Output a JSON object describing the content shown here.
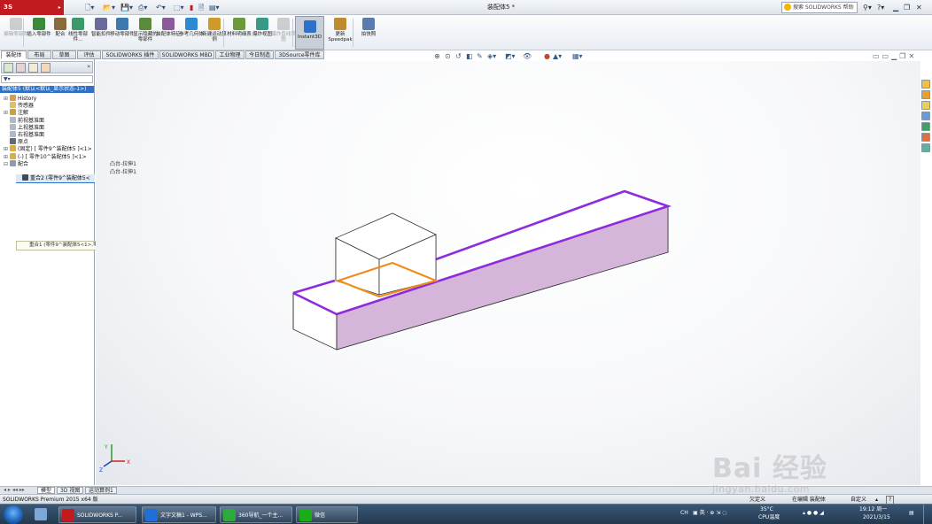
{
  "app": {
    "title": "装配体5 *",
    "help_search_placeholder": "搜索 SOLIDWORKS 帮助"
  },
  "command_manager": {
    "items": [
      {
        "label": "编辑零部件",
        "icon": "edit-component-icon",
        "enabled": false
      },
      {
        "label": "插入零部件",
        "icon": "insert-component-icon",
        "enabled": true
      },
      {
        "label": "配合",
        "icon": "mate-icon",
        "enabled": true
      },
      {
        "label": "线性零部件...",
        "icon": "linear-pattern-icon",
        "enabled": true
      },
      {
        "label": "智能扣件",
        "icon": "smart-fastener-icon",
        "enabled": true
      },
      {
        "label": "移动零部件",
        "icon": "move-component-icon",
        "enabled": true
      },
      {
        "label": "显示隐藏的零部件",
        "icon": "show-hidden-icon",
        "enabled": true
      },
      {
        "label": "装配体特征",
        "icon": "assembly-feature-icon",
        "enabled": true
      },
      {
        "label": "参考几何体",
        "icon": "reference-geometry-icon",
        "enabled": true
      },
      {
        "label": "新建运动算例",
        "icon": "motion-study-icon",
        "enabled": true
      },
      {
        "label": "材料明细表",
        "icon": "bom-icon",
        "enabled": true
      },
      {
        "label": "爆炸视图",
        "icon": "exploded-view-icon",
        "enabled": true
      },
      {
        "label": "爆炸直线草图",
        "icon": "explode-line-sketch-icon",
        "enabled": false
      },
      {
        "label": "Instant3D",
        "icon": "instant3d-icon",
        "enabled": true
      },
      {
        "label": "更新Speedpak",
        "icon": "speedpak-icon",
        "enabled": true
      },
      {
        "label": "拍快照",
        "icon": "snapshot-icon",
        "enabled": true
      }
    ]
  },
  "tabs": [
    "装配体",
    "布局",
    "草图",
    "评估",
    "SOLIDWORKS 插件",
    "SOLIDWORKS MBD",
    "工业物理",
    "今日制造",
    "3DSource零件库"
  ],
  "active_tab": "装配体",
  "feature_tree": {
    "filter": "▼▾",
    "root": "装配体5  (默认<默认_显示状态-1>)",
    "items": [
      {
        "label": "History",
        "icon": "history-icon"
      },
      {
        "label": "传感器",
        "icon": "sensor-icon"
      },
      {
        "label": "注解",
        "icon": "annotation-icon"
      },
      {
        "label": "前视基准面",
        "icon": "plane-icon"
      },
      {
        "label": "上视基准面",
        "icon": "plane-icon"
      },
      {
        "label": "右视基准面",
        "icon": "plane-icon"
      },
      {
        "label": "原点",
        "icon": "origin-icon"
      },
      {
        "label": "(固定) [ 零件9^装配体5 ]<1>",
        "icon": "part-icon"
      },
      {
        "label": "(-) [ 零件10^装配体5 ]<1>",
        "icon": "part-icon"
      },
      {
        "label": "配合",
        "icon": "mates-folder-icon"
      },
      {
        "label": "重合1 (零件9^装配体5<1>,零件10^装配体5<1>)",
        "icon": "coincident-icon"
      },
      {
        "label": "重合2 (零件9^装配体5<",
        "icon": "coincident-icon"
      }
    ],
    "callouts": [
      "凸台-拉伸1",
      "凸台-拉伸1"
    ]
  },
  "bottom_tabs": [
    "模型",
    "3D 视图",
    "运动算例1"
  ],
  "active_bottom_tab": "模型",
  "status": {
    "product": "SOLIDWORKS Premium 2015 x64 版",
    "state": "欠定义",
    "editing": "在编辑 装配体",
    "units": "自定义",
    "help": "?"
  },
  "taskbar": {
    "items": [
      {
        "label": "SOLIDWORKS P...",
        "icon": "solidworks-icon",
        "color": "#c11b20"
      },
      {
        "label": "文字文稿1 - WPS...",
        "icon": "wps-writer-icon",
        "color": "#1f6fd6"
      },
      {
        "label": "360导航_一个主...",
        "icon": "browser-360-icon",
        "color": "#2dab3a"
      },
      {
        "label": "微信",
        "icon": "wechat-icon",
        "color": "#1aad19"
      }
    ],
    "tray": {
      "ime": "CH",
      "temperature": "35°C",
      "temperature_label": "CPU温度",
      "time": "19:12 周一",
      "date": "2021/3/15"
    }
  },
  "watermark": {
    "brand": "Bai 经验",
    "url": "jingyan.baidu.com"
  },
  "colors": {
    "accent": "#2e71c9",
    "selected_edge": "#8e2bdc",
    "mate_edge": "#f08a1c",
    "shaded_face": "#d6b5da",
    "brand_red": "#c11b20"
  }
}
